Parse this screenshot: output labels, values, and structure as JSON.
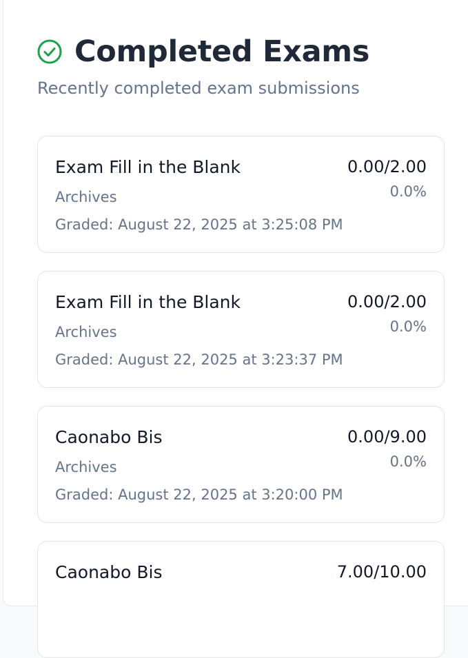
{
  "header": {
    "title": "Completed Exams",
    "subtitle": "Recently completed exam submissions",
    "icon": "check-circle-icon",
    "icon_color": "#16a34a"
  },
  "exams": [
    {
      "name": "Exam Fill in the Blank",
      "course": "Archives",
      "graded": "Graded: August 22, 2025 at 3:25:08 PM",
      "score": "0.00/2.00",
      "percent": "0.0%"
    },
    {
      "name": "Exam Fill in the Blank",
      "course": "Archives",
      "graded": "Graded: August 22, 2025 at 3:23:37 PM",
      "score": "0.00/2.00",
      "percent": "0.0%"
    },
    {
      "name": "Caonabo Bis",
      "course": "Archives",
      "graded": "Graded: August 22, 2025 at 3:20:00 PM",
      "score": "0.00/9.00",
      "percent": "0.0%"
    },
    {
      "name": "Caonabo Bis",
      "course": "",
      "graded": "",
      "score": "7.00/10.00",
      "percent": ""
    }
  ]
}
